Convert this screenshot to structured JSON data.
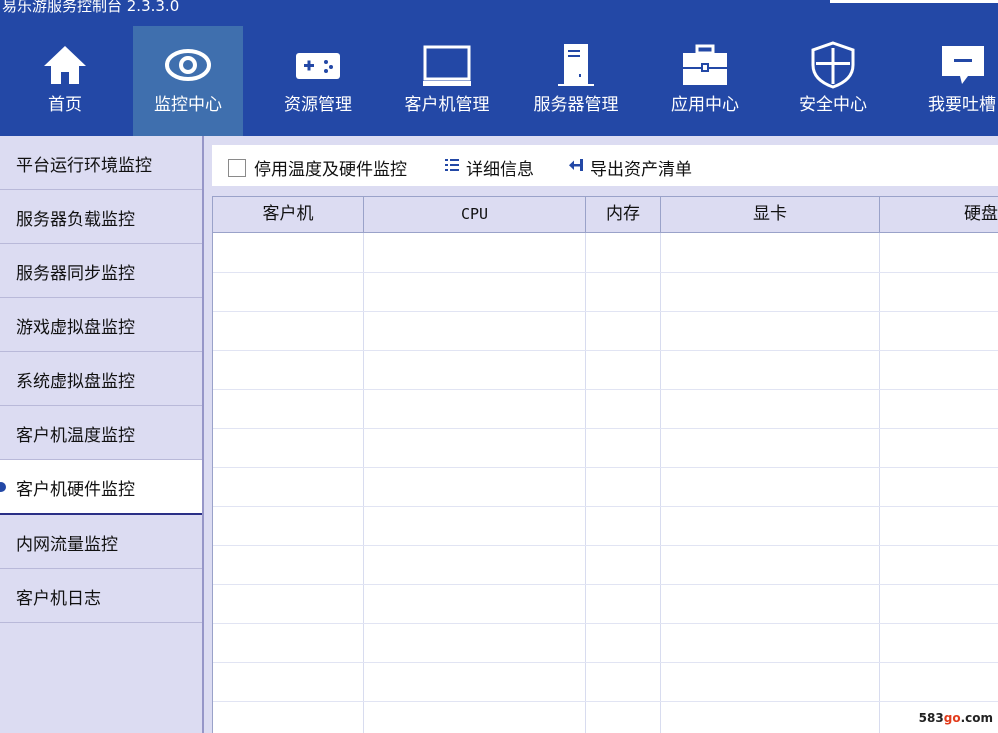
{
  "window": {
    "title": "易乐游服务控制台 2.3.3.0"
  },
  "nav": {
    "items": [
      {
        "label": "首页",
        "icon": "home-icon"
      },
      {
        "label": "监控中心",
        "icon": "eye-icon",
        "active": true
      },
      {
        "label": "资源管理",
        "icon": "gamepad-icon"
      },
      {
        "label": "客户机管理",
        "icon": "monitor-icon"
      },
      {
        "label": "服务器管理",
        "icon": "server-icon"
      },
      {
        "label": "应用中心",
        "icon": "toolbox-icon"
      },
      {
        "label": "安全中心",
        "icon": "shield-icon"
      },
      {
        "label": "我要吐槽",
        "icon": "feedback-icon"
      }
    ]
  },
  "sidebar": {
    "items": [
      {
        "label": "平台运行环境监控"
      },
      {
        "label": "服务器负载监控"
      },
      {
        "label": "服务器同步监控"
      },
      {
        "label": "游戏虚拟盘监控"
      },
      {
        "label": "系统虚拟盘监控"
      },
      {
        "label": "客户机温度监控"
      },
      {
        "label": "客户机硬件监控",
        "active": true
      },
      {
        "label": "内网流量监控"
      },
      {
        "label": "客户机日志"
      }
    ]
  },
  "toolbar": {
    "disable_checkbox_label": "停用温度及硬件监控",
    "disable_checked": false,
    "details_label": "详细信息",
    "export_label": "导出资产清单"
  },
  "table": {
    "columns": [
      "客户机",
      "CPU",
      "内存",
      "显卡",
      "硬盘"
    ],
    "rows": []
  },
  "watermark": {
    "text_a": "583",
    "text_b": "go",
    "text_c": ".com"
  },
  "colors": {
    "accent": "#2348a6",
    "active_nav": "#3f6fae",
    "sidebar_bg": "#dcdcf2"
  }
}
